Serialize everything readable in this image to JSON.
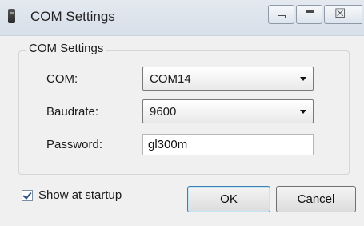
{
  "window": {
    "title": "COM Settings",
    "icon": "device-icon",
    "controls": [
      "minimize-icon",
      "maximize-icon",
      "close-icon"
    ],
    "close_glyph": "☒"
  },
  "group": {
    "title": "COM Settings",
    "com": {
      "label": "COM:",
      "value": "COM14"
    },
    "baudrate": {
      "label": "Baudrate:",
      "value": "9600"
    },
    "password": {
      "label": "Password:",
      "value": "gl300m"
    }
  },
  "footer": {
    "show_at_startup": {
      "label": "Show at startup",
      "checked": true
    },
    "ok_label": "OK",
    "cancel_label": "Cancel"
  },
  "colors": {
    "titlebar": "#dce3ec",
    "dialog_bg": "#f0f0f0",
    "ok_focus_border": "#3c7fb1"
  }
}
